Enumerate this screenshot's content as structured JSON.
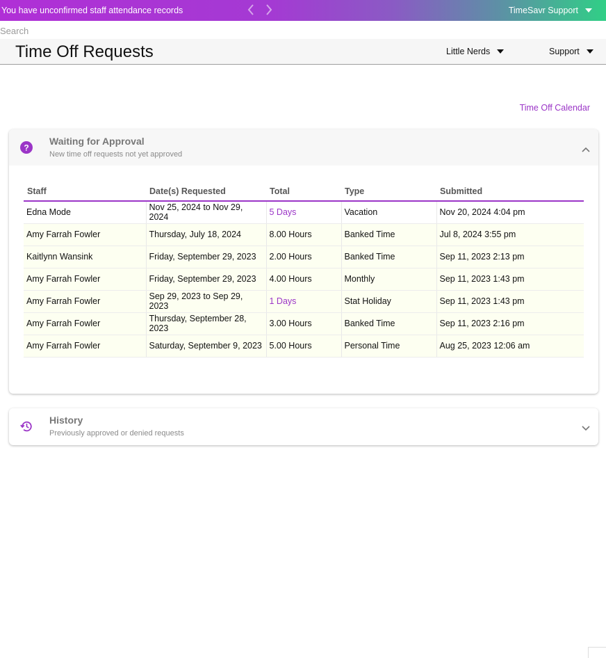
{
  "topbar": {
    "notice": "You have unconfirmed staff attendance records",
    "support_label": "TimeSavr Support"
  },
  "search": {
    "placeholder": "Search"
  },
  "header": {
    "title": "Time Off Requests",
    "org_label": "Little Nerds",
    "support_label": "Support"
  },
  "calendar_link": "Time Off Calendar",
  "approval": {
    "title": "Waiting for Approval",
    "subtitle": "New time off requests not yet approved",
    "columns": [
      "Staff",
      "Date(s) Requested",
      "Total",
      "Type",
      "Submitted"
    ],
    "rows": [
      {
        "staff": "Edna Mode",
        "dates": "Nov 25, 2024 to Nov 29, 2024",
        "total": "5 Days",
        "type": "Vacation",
        "submitted": "Nov 20, 2024 4:04 pm"
      },
      {
        "staff": "Amy Farrah Fowler",
        "dates": "Thursday, July 18, 2024",
        "total": "8.00 Hours",
        "type": "Banked Time",
        "submitted": "Jul 8, 2024 3:55 pm"
      },
      {
        "staff": "Kaitlynn Wansink",
        "dates": "Friday, September 29, 2023",
        "total": "2.00 Hours",
        "type": "Banked Time",
        "submitted": "Sep 11, 2023 2:13 pm"
      },
      {
        "staff": "Amy Farrah Fowler",
        "dates": "Friday, September 29, 2023",
        "total": "4.00 Hours",
        "type": "Monthly",
        "submitted": "Sep 11, 2023 1:43 pm"
      },
      {
        "staff": "Amy Farrah Fowler",
        "dates": "Sep 29, 2023 to Sep 29, 2023",
        "total": "1 Days",
        "type": "Stat Holiday",
        "submitted": "Sep 11, 2023 1:43 pm"
      },
      {
        "staff": "Amy Farrah Fowler",
        "dates": "Thursday, September 28, 2023",
        "total": "3.00 Hours",
        "type": "Banked Time",
        "submitted": "Sep 11, 2023 2:16 pm"
      },
      {
        "staff": "Amy Farrah Fowler",
        "dates": "Saturday, September 9, 2023",
        "total": "5.00 Hours",
        "type": "Personal Time",
        "submitted": "Aug 25, 2023 12:06 am"
      }
    ]
  },
  "history": {
    "title": "History",
    "subtitle": "Previously approved or denied requests"
  },
  "colors": {
    "accent": "#9b35c7",
    "row_highlight": "#fdfff1",
    "header_bg": "#f6f6f6"
  },
  "icons": {
    "approval": "help-circle-icon",
    "history": "history-icon",
    "prev": "chevron-left-icon",
    "next": "chevron-right-icon"
  }
}
